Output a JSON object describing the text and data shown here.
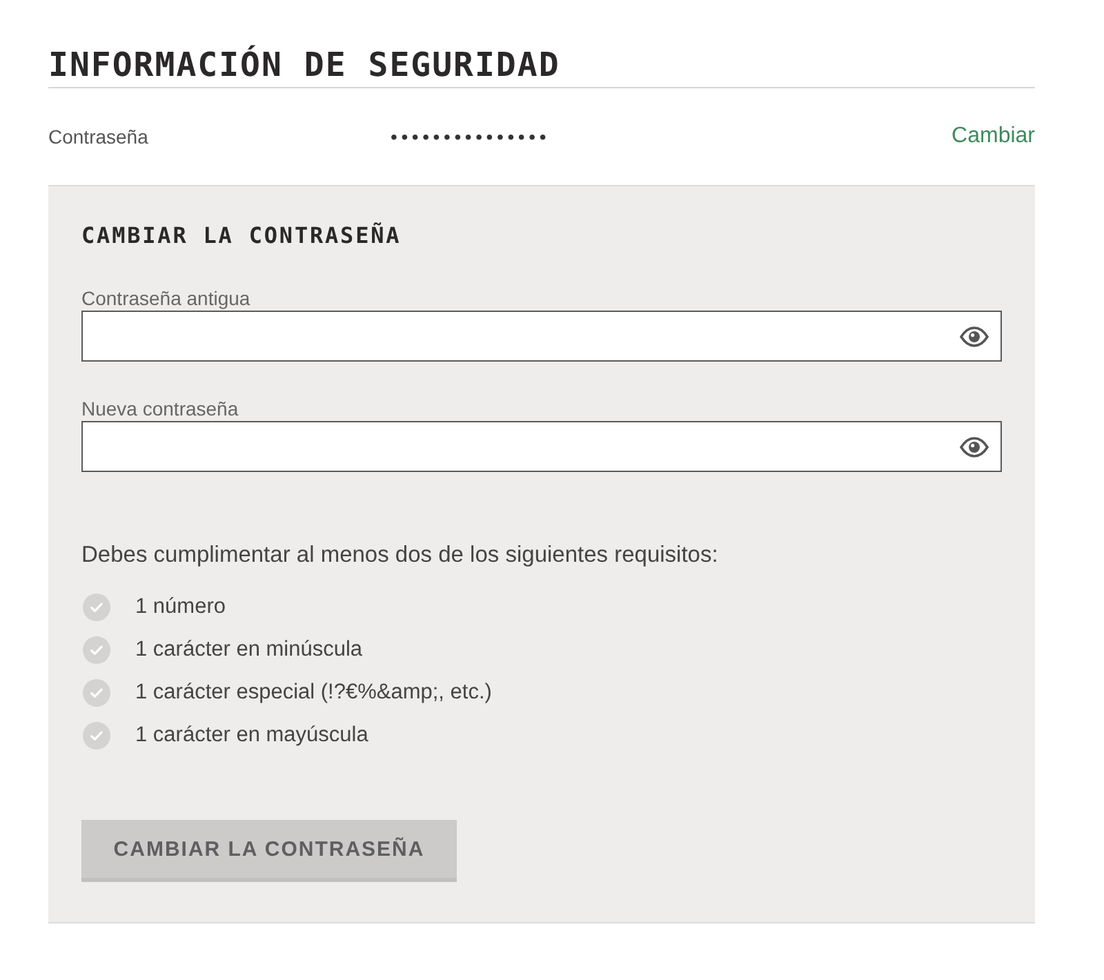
{
  "section": {
    "title": "INFORMACIÓN DE SEGURIDAD"
  },
  "password_row": {
    "label": "Contraseña",
    "value": "•••••••••••••••",
    "link": "Cambiar"
  },
  "change_password": {
    "title": "CAMBIAR LA CONTRASEÑA",
    "fields": [
      {
        "label": "Contraseña antigua"
      },
      {
        "label": "Nueva contraseña"
      }
    ],
    "requirements_intro": "Debes cumplimentar al menos dos de los siguientes requisitos:",
    "requirements": [
      {
        "text": "1 número",
        "met": false
      },
      {
        "text": "1 carácter en minúscula",
        "met": false
      },
      {
        "text": "1 carácter especial (!?€%&amp;, etc.)",
        "met": false
      },
      {
        "text": "1 carácter en mayúscula",
        "met": false
      }
    ],
    "submit": {
      "label": "CAMBIAR LA CONTRASEÑA",
      "disabled": true
    }
  }
}
